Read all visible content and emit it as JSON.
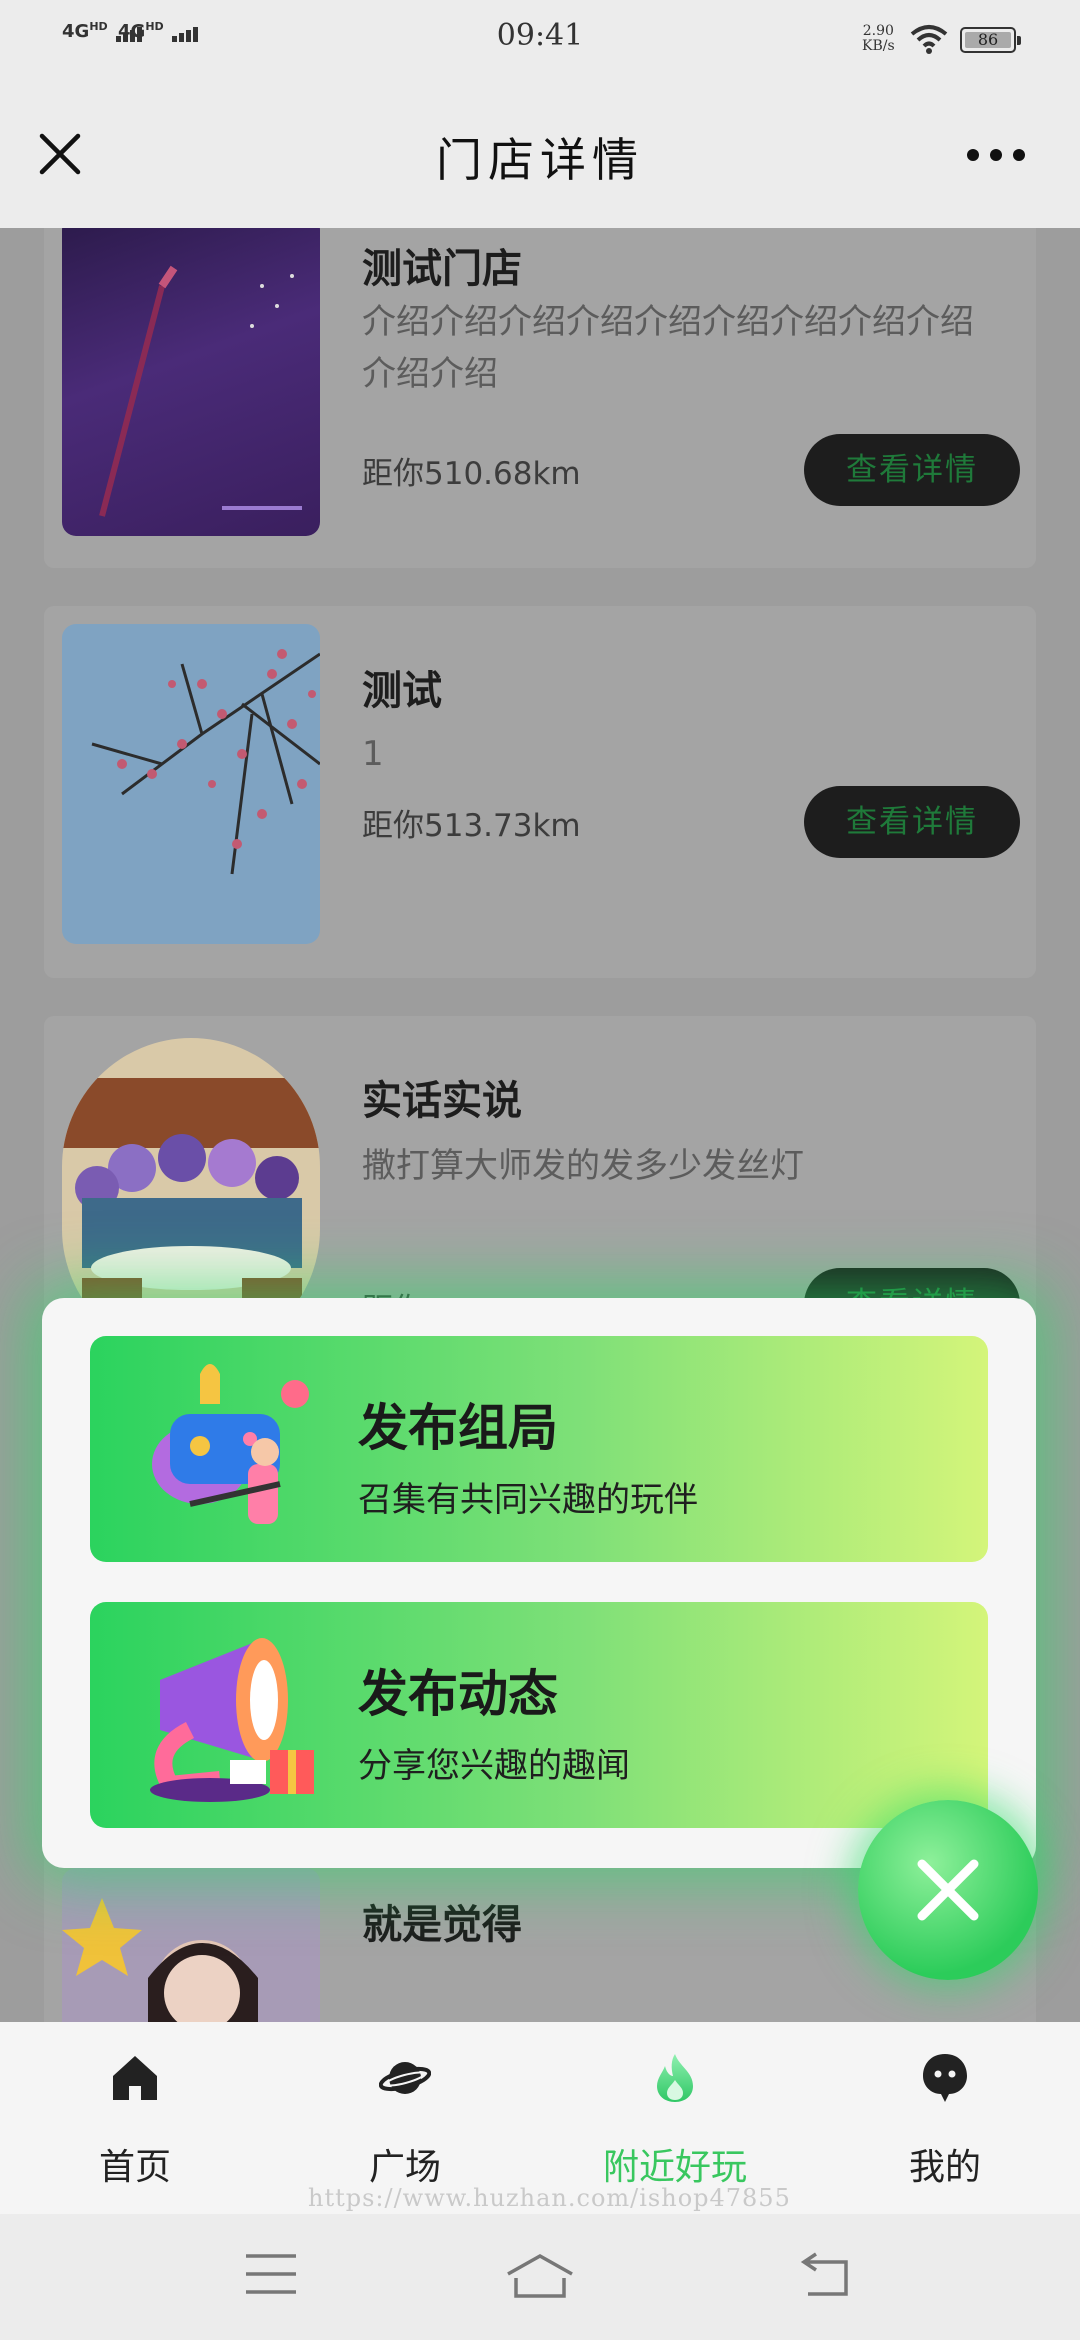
{
  "status_bar": {
    "signal_1": "4G",
    "signal_1_sup": "HD",
    "signal_2": "4G",
    "signal_2_sup": "HD",
    "time": "09:41",
    "net_speed_value": "2.90",
    "net_speed_unit": "KB/s",
    "battery": "86"
  },
  "nav": {
    "title": "门店详情",
    "close_icon": "close-icon",
    "more_icon": "more-dots-icon"
  },
  "stores": [
    {
      "name": "测试门店",
      "desc": "介绍介绍介绍介绍介绍介绍介绍介绍介绍介绍介绍",
      "distance": "距你510.68km",
      "button": "查看详情"
    },
    {
      "name": "测试",
      "desc": "1",
      "distance": "距你513.73km",
      "button": "查看详情"
    },
    {
      "name": "实话实说",
      "desc": "撒打算大师发的发多少发丝灯",
      "distance": "距你",
      "button": "查看详情"
    },
    {
      "name": "就是觉得",
      "desc": "",
      "distance": "",
      "button": ""
    }
  ],
  "popup": {
    "actions": [
      {
        "title": "发布组局",
        "subtitle": "召集有共同兴趣的玩伴",
        "icon": "game-party-illustration"
      },
      {
        "title": "发布动态",
        "subtitle": "分享您兴趣的趣闻",
        "icon": "megaphone-illustration"
      }
    ]
  },
  "fab": {
    "icon": "close-icon"
  },
  "tabs": [
    {
      "label": "首页",
      "icon": "home-icon",
      "active": false
    },
    {
      "label": "广场",
      "icon": "planet-icon",
      "active": false
    },
    {
      "label": "附近好玩",
      "icon": "flame-icon",
      "active": true
    },
    {
      "label": "我的",
      "icon": "profile-icon",
      "active": false
    }
  ],
  "watermark": "https://www.huzhan.com/ishop47855",
  "colors": {
    "accent": "#39c75f",
    "button_bg": "#1d1d1d",
    "gradient_start": "#2bd35e",
    "gradient_end": "#d4f57a"
  }
}
